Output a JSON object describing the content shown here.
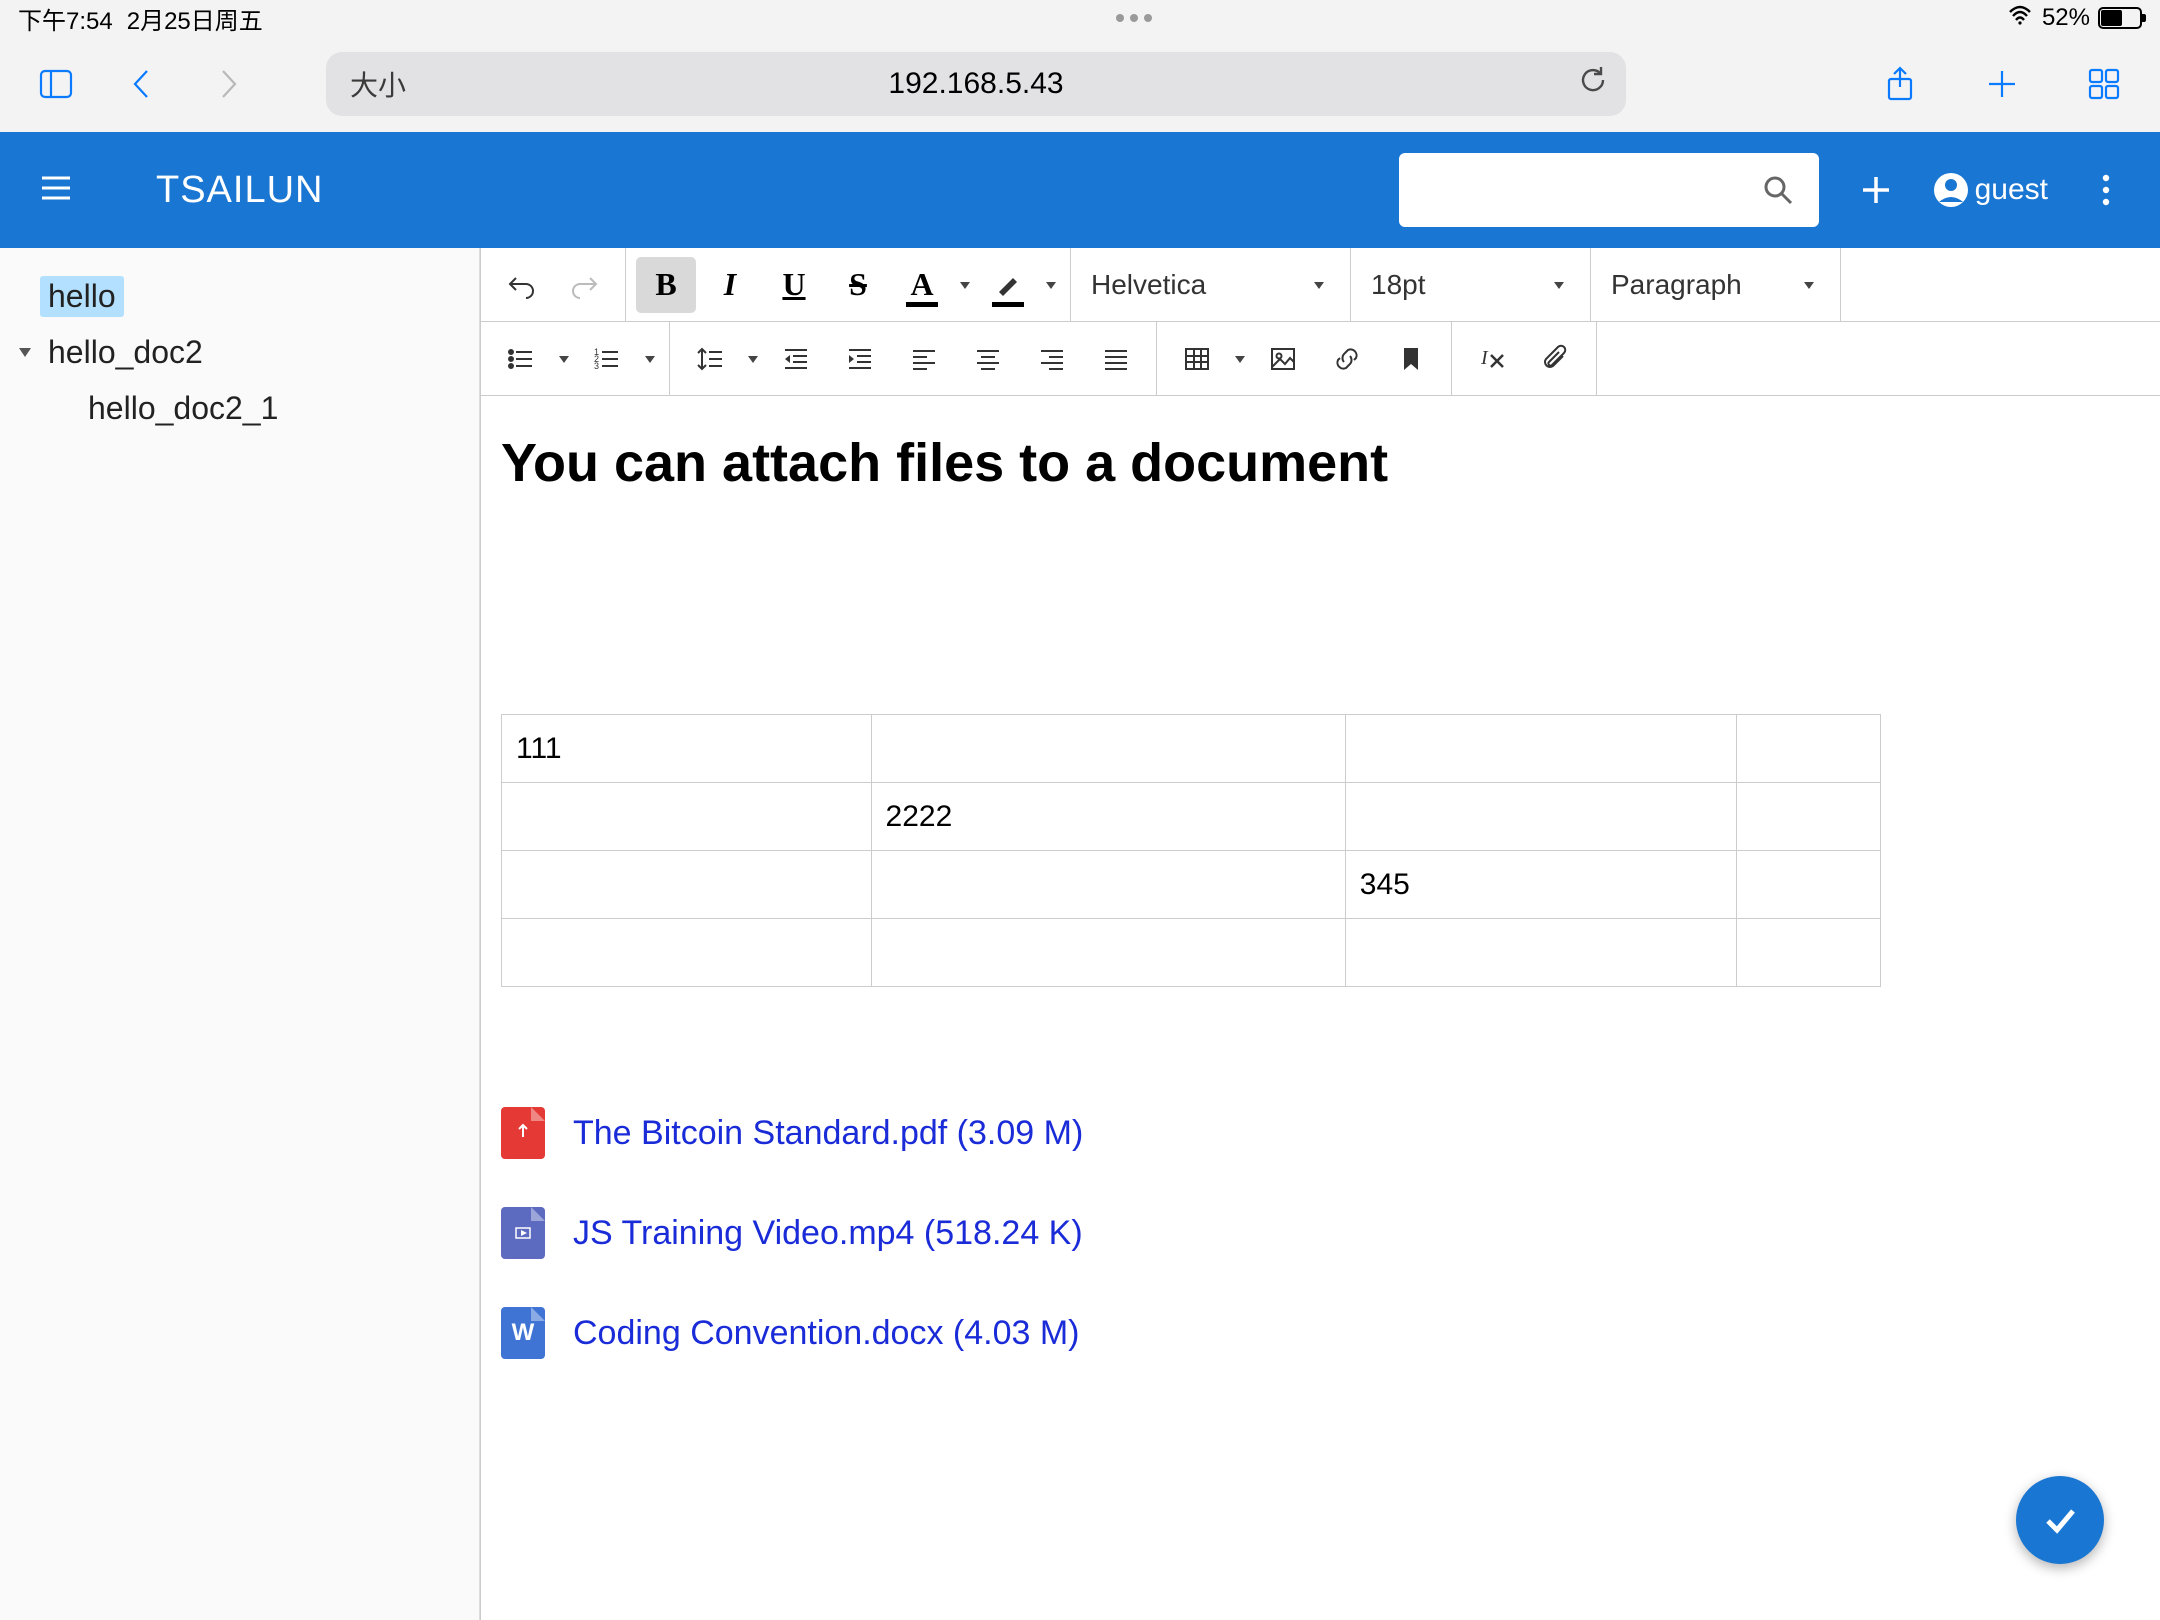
{
  "status": {
    "time": "下午7:54",
    "date": "2月25日周五",
    "battery_pct": "52%"
  },
  "safari": {
    "size_label": "大小",
    "url": "192.168.5.43"
  },
  "header": {
    "app_name": "TSAILUN",
    "user_label": "guest"
  },
  "tree": {
    "items": [
      {
        "label": "hello",
        "selected": true,
        "indent": 0,
        "caret": false
      },
      {
        "label": "hello_doc2",
        "selected": false,
        "indent": 1,
        "caret": true
      },
      {
        "label": "hello_doc2_1",
        "selected": false,
        "indent": 2,
        "caret": false
      }
    ]
  },
  "toolbar": {
    "font": "Helvetica",
    "size": "18pt",
    "paragraph": "Paragraph"
  },
  "document": {
    "heading": "You can attach files to a document",
    "table": [
      [
        "111",
        "",
        "",
        ""
      ],
      [
        "",
        "2222",
        "",
        ""
      ],
      [
        "",
        "",
        "345",
        ""
      ],
      [
        "",
        "",
        "",
        ""
      ]
    ],
    "attachments": [
      {
        "icon": "pdf",
        "label": "The Bitcoin Standard.pdf (3.09 M)"
      },
      {
        "icon": "vid",
        "label": "JS Training Video.mp4 (518.24 K)"
      },
      {
        "icon": "doc",
        "label": "Coding Convention.docx (4.03 M)"
      }
    ]
  }
}
